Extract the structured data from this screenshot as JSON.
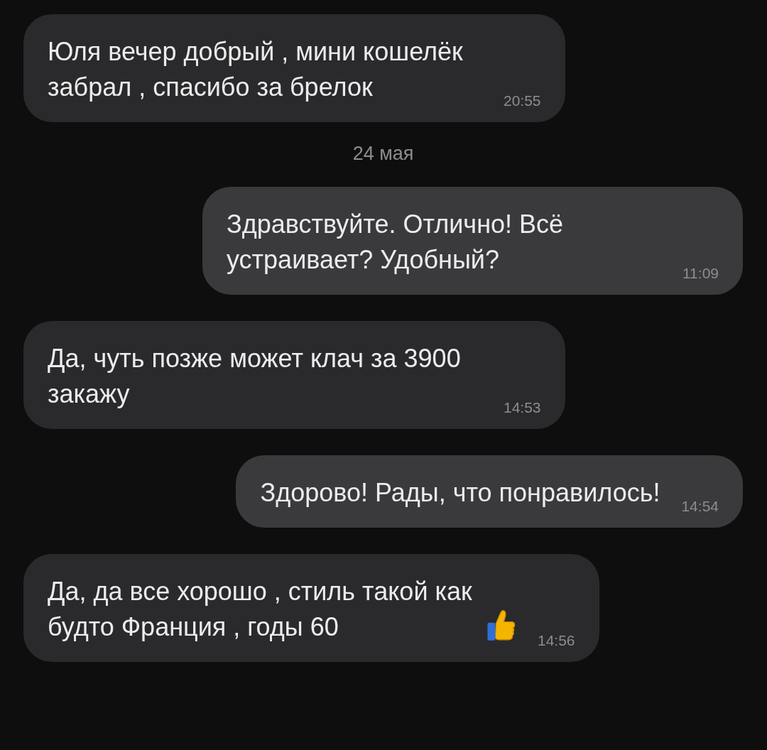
{
  "messages": [
    {
      "kind": "incoming",
      "text": "Юля вечер добрый , мини кошелёк забрал , спасибо за брелок",
      "time": "20:55"
    },
    {
      "kind": "date",
      "text": "24 мая"
    },
    {
      "kind": "outgoing",
      "text": "Здравствуйте. Отлично! Всё устраивает? Удобный?",
      "time": "11:09"
    },
    {
      "kind": "incoming",
      "text": "Да, чуть позже может клач за 3900 закажу",
      "time": "14:53"
    },
    {
      "kind": "outgoing",
      "text": "Здорово! Рады, что понравилось!",
      "time": "14:54"
    },
    {
      "kind": "incoming",
      "text": "Да, да все хорошо , стиль такой как будто Франция , годы 60",
      "time": "14:56",
      "thumbs_up": true
    }
  ]
}
